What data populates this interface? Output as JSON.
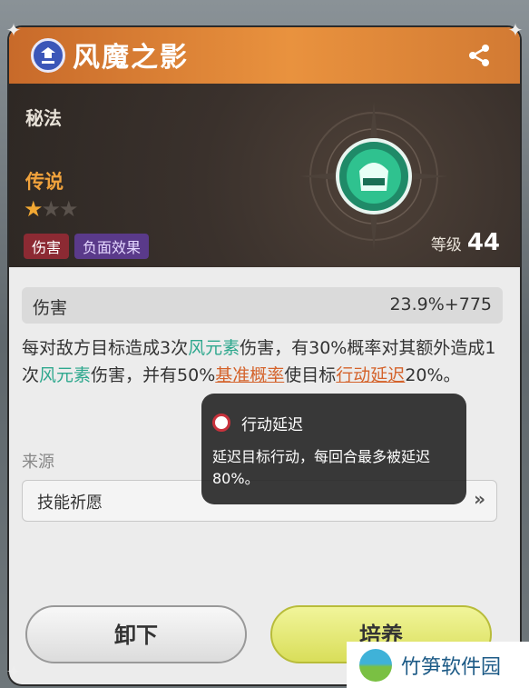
{
  "header": {
    "title": "风魔之影"
  },
  "hero": {
    "category": "秘法",
    "rarity": "传说",
    "stars_filled": 1,
    "stars_total": 3,
    "tags": [
      "伤害",
      "负面效果"
    ],
    "level_label": "等级",
    "level_value": "44"
  },
  "stat": {
    "label": "伤害",
    "value": "23.9%+775"
  },
  "desc": {
    "p1": "每对敌方目标造成3次",
    "w1": "风元素",
    "p2": "伤害，有30%概率对其额外造成1次",
    "w2": "风元素",
    "p3": "伤害，并有50%",
    "k1": "基准概率",
    "p4": "使目标",
    "k2": "行动延迟",
    "p5": "20%。"
  },
  "source": {
    "label": "来源",
    "item": "技能祈愿",
    "arrow": "»"
  },
  "tooltip": {
    "title": "行动延迟",
    "body": "延迟目标行动，每回合最多被延迟80%。"
  },
  "buttons": {
    "unequip": "卸下",
    "train": "培养"
  },
  "watermark": {
    "text": "竹笋软件园"
  }
}
